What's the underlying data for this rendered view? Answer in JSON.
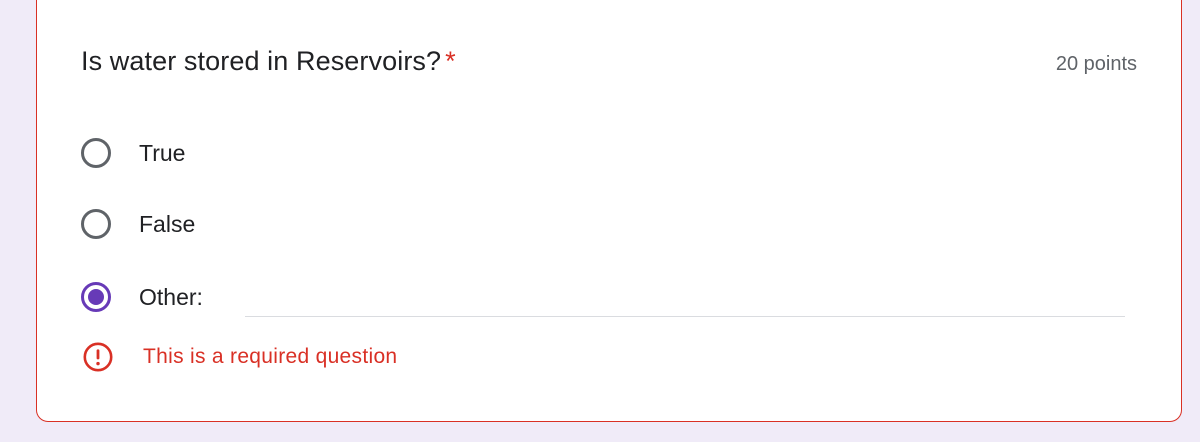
{
  "question": {
    "title": "Is water stored in Reservoirs?",
    "required_marker": "*",
    "points": "20 points"
  },
  "options": [
    {
      "label": "True",
      "selected": false
    },
    {
      "label": "False",
      "selected": false
    },
    {
      "label": "Other:",
      "selected": true
    }
  ],
  "other_input": {
    "value": ""
  },
  "error": {
    "icon": "error-circle-exclamation-icon",
    "message": "This is a required question"
  },
  "colors": {
    "page_background": "#f0ebf8",
    "error_red": "#d93025",
    "accent_purple": "#673ab7",
    "text": "#202124",
    "secondary_text": "#5f6368"
  }
}
